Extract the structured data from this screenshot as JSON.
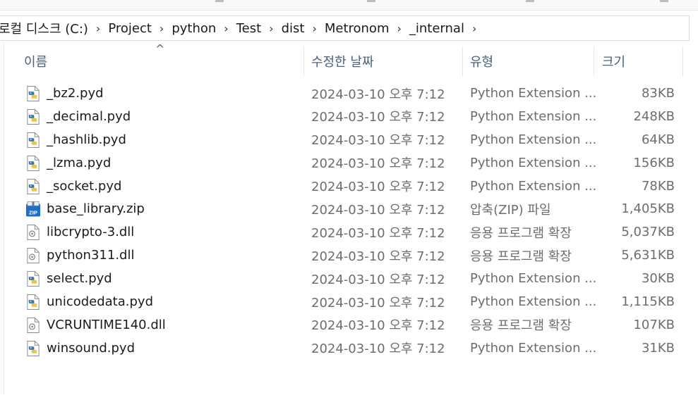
{
  "breadcrumb": [
    "로컬 디스크 (C:)",
    "Project",
    "python",
    "Test",
    "dist",
    "Metronom",
    "_internal"
  ],
  "columns": {
    "name": "이름",
    "date": "수정한 날짜",
    "type": "유형",
    "size": "크기"
  },
  "files": [
    {
      "name": "_bz2.pyd",
      "date": "2024-03-10 오후 7:12",
      "type": "Python Extension ...",
      "size": "83KB",
      "icon": "python-file-icon"
    },
    {
      "name": "_decimal.pyd",
      "date": "2024-03-10 오후 7:12",
      "type": "Python Extension ...",
      "size": "248KB",
      "icon": "python-file-icon"
    },
    {
      "name": "_hashlib.pyd",
      "date": "2024-03-10 오후 7:12",
      "type": "Python Extension ...",
      "size": "64KB",
      "icon": "python-file-icon"
    },
    {
      "name": "_lzma.pyd",
      "date": "2024-03-10 오후 7:12",
      "type": "Python Extension ...",
      "size": "156KB",
      "icon": "python-file-icon"
    },
    {
      "name": "_socket.pyd",
      "date": "2024-03-10 오후 7:12",
      "type": "Python Extension ...",
      "size": "78KB",
      "icon": "python-file-icon"
    },
    {
      "name": "base_library.zip",
      "date": "2024-03-10 오후 7:12",
      "type": "압축(ZIP) 파일",
      "size": "1,405KB",
      "icon": "zip-file-icon"
    },
    {
      "name": "libcrypto-3.dll",
      "date": "2024-03-10 오후 7:12",
      "type": "응용 프로그램 확장",
      "size": "5,037KB",
      "icon": "dll-file-icon"
    },
    {
      "name": "python311.dll",
      "date": "2024-03-10 오후 7:12",
      "type": "응용 프로그램 확장",
      "size": "5,631KB",
      "icon": "dll-file-icon"
    },
    {
      "name": "select.pyd",
      "date": "2024-03-10 오후 7:12",
      "type": "Python Extension ...",
      "size": "30KB",
      "icon": "python-file-icon"
    },
    {
      "name": "unicodedata.pyd",
      "date": "2024-03-10 오후 7:12",
      "type": "Python Extension ...",
      "size": "1,115KB",
      "icon": "python-file-icon"
    },
    {
      "name": "VCRUNTIME140.dll",
      "date": "2024-03-10 오후 7:12",
      "type": "응용 프로그램 확장",
      "size": "107KB",
      "icon": "dll-file-icon"
    },
    {
      "name": "winsound.pyd",
      "date": "2024-03-10 오후 7:12",
      "type": "Python Extension ...",
      "size": "31KB",
      "icon": "python-file-icon"
    }
  ],
  "colors": {
    "header_text": "#4c607a",
    "secondary_text": "#6d6d6d",
    "python_blue": "#3b77a8",
    "python_yellow": "#f2c43c",
    "zip_blue": "#1e6fc9"
  }
}
